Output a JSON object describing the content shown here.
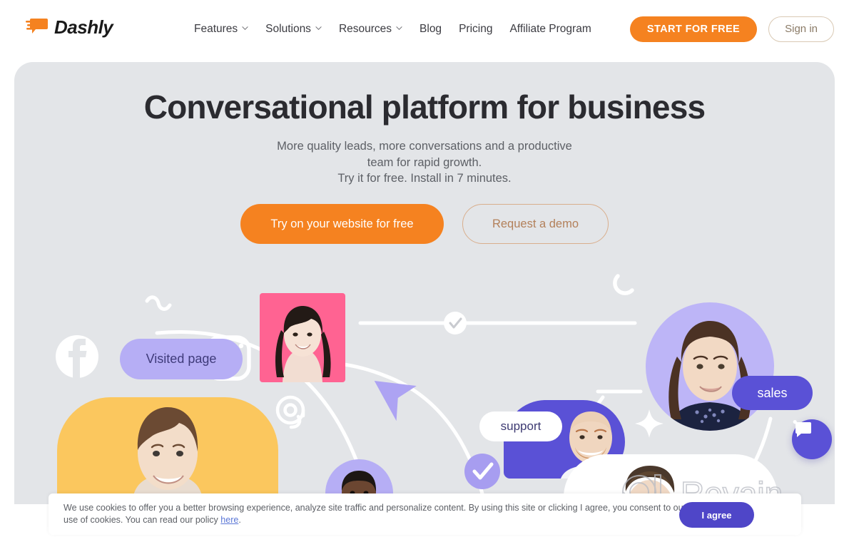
{
  "brand": {
    "name": "Dashly",
    "logo_icon": "dashly-speech-bubble-icon",
    "accent_orange": "#F58220",
    "accent_purple": "#5A51D6",
    "hero_bg": "#E3E5E8"
  },
  "nav": {
    "links": [
      {
        "label": "Features",
        "has_dropdown": true
      },
      {
        "label": "Solutions",
        "has_dropdown": true
      },
      {
        "label": "Resources",
        "has_dropdown": true
      },
      {
        "label": "Blog",
        "has_dropdown": false
      },
      {
        "label": "Pricing",
        "has_dropdown": false
      },
      {
        "label": "Affiliate Program",
        "has_dropdown": false
      }
    ],
    "start_label": "START FOR FREE",
    "signin_label": "Sign in"
  },
  "hero": {
    "title": "Conversational platform for business",
    "subtitle_line1": "More quality leads, more conversations and a productive",
    "subtitle_line2": "team for rapid growth.",
    "subtitle_line3": "Try it for free. Install in 7 minutes.",
    "cta_primary": "Try on your website for free",
    "cta_secondary": "Request a demo"
  },
  "illustration": {
    "tag_visited": "Visited page",
    "tag_support": "support",
    "tag_sales": "sales",
    "icons": [
      "facebook-icon",
      "instagram-icon",
      "at-symbol-icon",
      "squiggle-icon",
      "crescent-icon",
      "sparkle-icon",
      "check-circle-icon",
      "cursor-arrow-icon"
    ]
  },
  "chat_widget": {
    "icon": "chat-bubble-icon"
  },
  "watermark": {
    "text": "Revain",
    "icon": "revain-logo-icon"
  },
  "cookie": {
    "text_before_link": "We use cookies to offer you a better browsing experience, analyze site traffic and personalize content. By using this site or clicking I agree, you consent to our use of cookies. You can read our policy ",
    "link_label": "here",
    "text_after_link": ".",
    "agree_label": "I agree"
  }
}
